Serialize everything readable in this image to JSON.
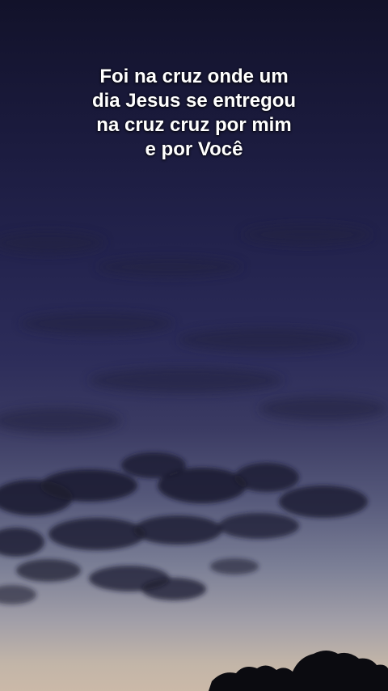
{
  "caption": {
    "lines": [
      "Foi na cruz onde um",
      "dia Jesus se entregou",
      "na cruz cruz por mim",
      "e por Você"
    ]
  },
  "colors": {
    "sky_top": "#12122a",
    "sky_middle": "#2d2d5a",
    "sky_horizon": "#cbb9a8",
    "clouds": "#1b1b30",
    "trees": "#0b0b10",
    "text": "#ffffff"
  }
}
